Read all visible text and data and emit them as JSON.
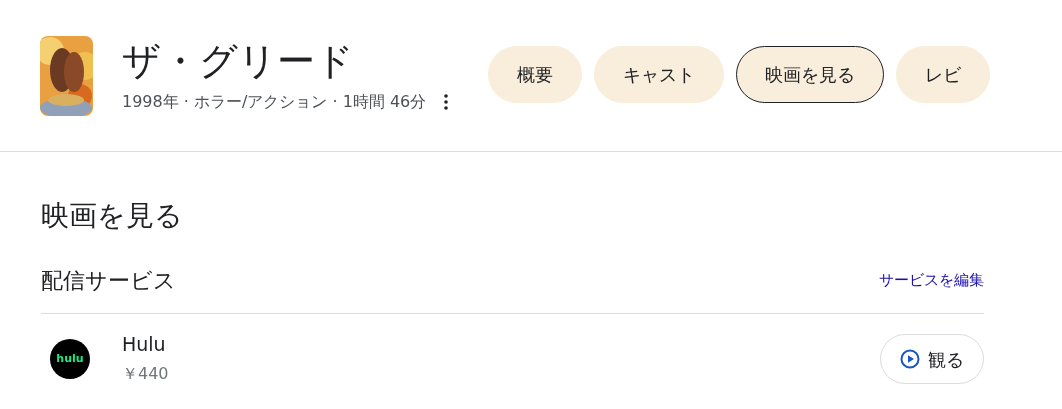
{
  "header": {
    "title": "ザ・グリード",
    "meta": "1998年 · ホラー/アクション · 1時間 46分"
  },
  "tabs": [
    {
      "label": "概要",
      "selected": false
    },
    {
      "label": "キャスト",
      "selected": false
    },
    {
      "label": "映画を見る",
      "selected": true
    },
    {
      "label": "レビ",
      "selected": false
    }
  ],
  "section": {
    "title": "映画を見る",
    "subtitle": "配信サービス",
    "edit_link": "サービスを編集"
  },
  "services": [
    {
      "logo_text": "hulu",
      "name": "Hulu",
      "price": "￥440",
      "button": "観る"
    }
  ]
}
